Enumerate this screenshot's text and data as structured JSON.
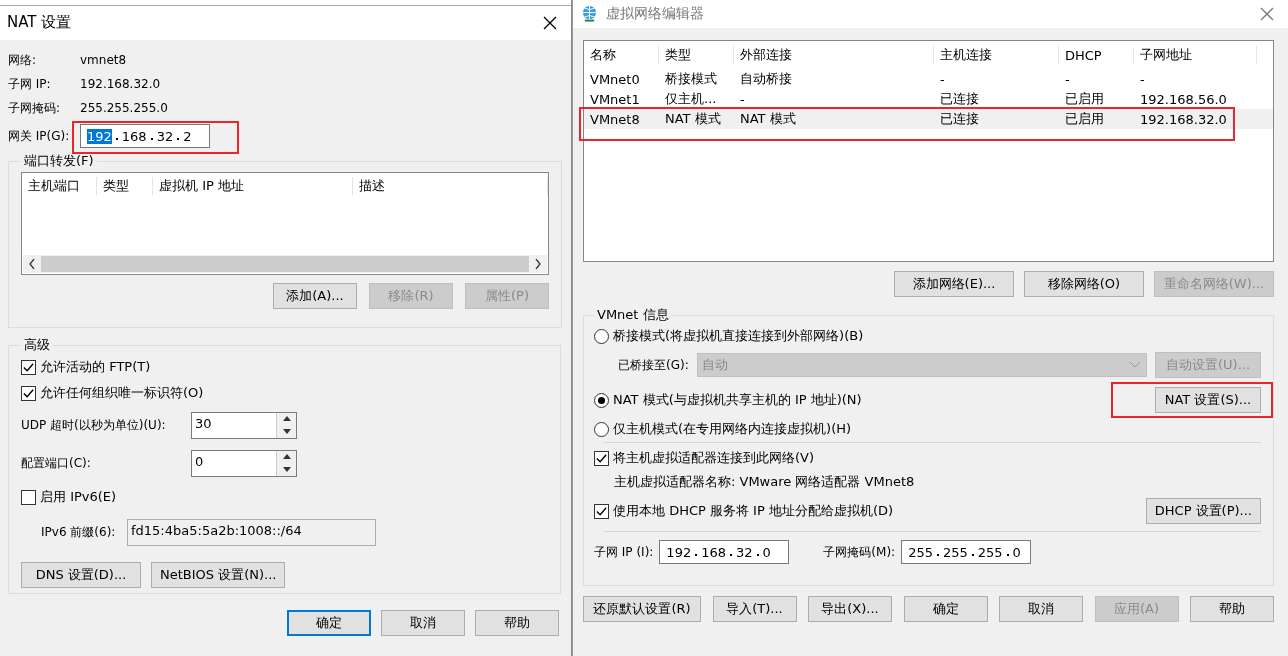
{
  "nat_dialog": {
    "title": "NAT 设置",
    "info": [
      {
        "label": "网络:",
        "value": "vmnet8"
      },
      {
        "label": "子网 IP:",
        "value": "192.168.32.0"
      },
      {
        "label": "子网掩码:",
        "value": "255.255.255.0"
      }
    ],
    "gateway": {
      "label": "网关 IP(G):",
      "highlighted": true,
      "octets": [
        {
          "text": "192",
          "selected": true
        },
        {
          "text": "168",
          "selected": false
        },
        {
          "text": "32",
          "selected": false
        },
        {
          "text": "2",
          "selected": false
        }
      ]
    },
    "port_forwarding": {
      "title": "端口转发(F)",
      "columns": [
        "主机端口",
        "类型",
        "虚拟机 IP 地址",
        "描述"
      ],
      "buttons": [
        {
          "label": "添加(A)...",
          "disabled": false
        },
        {
          "label": "移除(R)",
          "disabled": true
        },
        {
          "label": "属性(P)",
          "disabled": true
        }
      ]
    },
    "advanced": {
      "title": "高级",
      "checkboxes": [
        {
          "label": "允许活动的 FTP(T)",
          "checked": true
        },
        {
          "label": "允许任何组织唯一标识符(O)",
          "checked": true
        }
      ],
      "spinners": [
        {
          "label": "UDP 超时(以秒为单位)(U):",
          "value": "30"
        },
        {
          "label": "配置端口(C):",
          "value": "0"
        }
      ],
      "ipv6": {
        "label": "启用 IPv6(E)",
        "checked": false
      },
      "ipv6_prefix": {
        "label": "IPv6 前缀(6):",
        "value": "fd15:4ba5:5a2b:1008::/64",
        "disabled": true
      },
      "buttons": [
        {
          "label": "DNS 设置(D)...",
          "disabled": false
        },
        {
          "label": "NetBIOS 设置(N)...",
          "disabled": false
        }
      ]
    },
    "buttons": [
      {
        "label": "确定",
        "default": true
      },
      {
        "label": "取消",
        "default": false
      },
      {
        "label": "帮助",
        "default": false
      }
    ]
  },
  "network_editor": {
    "title": "虚拟网络编辑器",
    "columns": [
      "名称",
      "类型",
      "外部连接",
      "主机连接",
      "DHCP",
      "子网地址"
    ],
    "rows": [
      {
        "cells": [
          "VMnet0",
          "桥接模式",
          "自动桥接",
          "-",
          "-",
          "-"
        ],
        "selected": false,
        "highlighted": false
      },
      {
        "cells": [
          "VMnet1",
          "仅主机...",
          "-",
          "已连接",
          "已启用",
          "192.168.56.0"
        ],
        "selected": false,
        "highlighted": false
      },
      {
        "cells": [
          "VMnet8",
          "NAT 模式",
          "NAT 模式",
          "已连接",
          "已启用",
          "192.168.32.0"
        ],
        "selected": true,
        "highlighted": true
      }
    ],
    "list_buttons": [
      {
        "label": "添加网络(E)...",
        "disabled": false
      },
      {
        "label": "移除网络(O)",
        "disabled": false
      },
      {
        "label": "重命名网络(W)...",
        "disabled": true
      }
    ],
    "info": {
      "title": "VMnet 信息",
      "bridged_mode": {
        "label": "桥接模式(将虚拟机直接连接到外部网络)(B)",
        "selected": false
      },
      "bridged_to": {
        "label": "已桥接至(G):",
        "value": "自动",
        "disabled": true
      },
      "auto_button": {
        "label": "自动设置(U)...",
        "disabled": true
      },
      "nat_mode": {
        "label": "NAT 模式(与虚拟机共享主机的 IP 地址)(N)",
        "selected": true
      },
      "nat_button": {
        "label": "NAT 设置(S)...",
        "highlighted": true
      },
      "host_only_mode": {
        "label": "仅主机模式(在专用网络内连接虚拟机)(H)",
        "selected": false
      },
      "host_adapter": {
        "label": "将主机虚拟适配器连接到此网络(V)",
        "checked": true
      },
      "adapter_name": "主机虚拟适配器名称: VMware 网络适配器 VMnet8",
      "dhcp": {
        "label": "使用本地 DHCP 服务将 IP 地址分配给虚拟机(D)",
        "checked": true
      },
      "dhcp_button": {
        "label": "DHCP 设置(P)..."
      },
      "subnet_ip": {
        "label": "子网 IP (I):",
        "octets": [
          "192",
          "168",
          "32",
          "0"
        ]
      },
      "subnet_mask": {
        "label": "子网掩码(M):",
        "octets": [
          "255",
          "255",
          "255",
          "0"
        ]
      }
    },
    "buttons": [
      {
        "label": "还原默认设置(R)",
        "disabled": false
      },
      {
        "label": "导入(T)...",
        "disabled": false
      },
      {
        "label": "导出(X)...",
        "disabled": false
      },
      {
        "label": "确定",
        "disabled": false
      },
      {
        "label": "取消",
        "disabled": false
      },
      {
        "label": "应用(A)",
        "disabled": true
      },
      {
        "label": "帮助",
        "disabled": false
      }
    ]
  }
}
